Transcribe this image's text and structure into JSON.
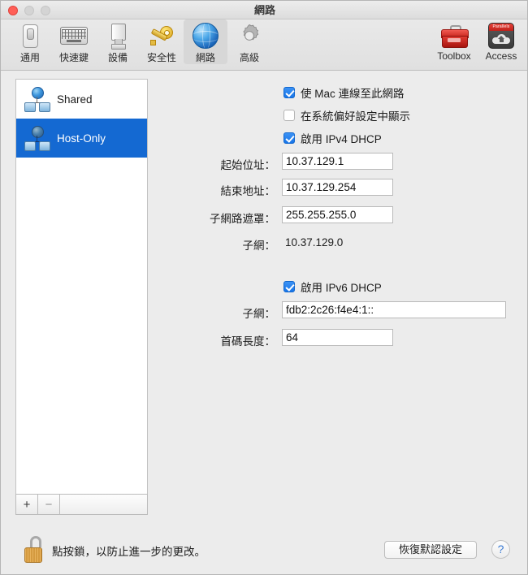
{
  "window": {
    "title": "網路",
    "traffic": {
      "close": "close-button",
      "minimize": "minimize-button",
      "zoom": "zoom-button"
    }
  },
  "toolbar": {
    "items": [
      {
        "label": "通用",
        "icon": "toggle-switch-icon",
        "selected": false
      },
      {
        "label": "快速鍵",
        "icon": "keyboard-icon",
        "selected": false
      },
      {
        "label": "設備",
        "icon": "usb-device-icon",
        "selected": false
      },
      {
        "label": "安全性",
        "icon": "key-icon",
        "selected": false
      },
      {
        "label": "網路",
        "icon": "globe-icon",
        "selected": true
      },
      {
        "label": "高級",
        "icon": "gear-icon",
        "selected": false
      }
    ],
    "right_items": [
      {
        "label": "Toolbox",
        "icon": "toolbox-icon"
      },
      {
        "label": "Access",
        "icon": "access-cloud-house-icon"
      }
    ]
  },
  "sidebar": {
    "items": [
      {
        "label": "Shared",
        "icon": "network-icon",
        "selected": false
      },
      {
        "label": "Host-Only",
        "icon": "network-icon",
        "selected": true
      }
    ],
    "add_label": "+",
    "remove_label": "−"
  },
  "main": {
    "checkboxes": [
      {
        "label": "使 Mac 連線至此網路",
        "checked": true
      },
      {
        "label": "在系統偏好設定中顯示",
        "checked": false
      },
      {
        "label": "啟用 IPv4 DHCP",
        "checked": true
      }
    ],
    "ipv4_fields": [
      {
        "label": "起始位址：",
        "value": "10.37.129.1"
      },
      {
        "label": "結束地址：",
        "value": "10.37.129.254"
      },
      {
        "label": "子網路遮罩：",
        "value": "255.255.255.0"
      }
    ],
    "ipv4_static": {
      "label": "子網：",
      "value": "10.37.129.0"
    },
    "ipv6_checkbox": {
      "label": "啟用 IPv6 DHCP",
      "checked": true
    },
    "ipv6_fields": [
      {
        "label": "子網：",
        "value": "fdb2:2c26:f4e4:1::"
      },
      {
        "label": "首碼長度：",
        "value": "64"
      }
    ]
  },
  "footer": {
    "lock_icon": "unlocked-padlock-icon",
    "lock_message": "點按鎖，以防止進一步的更改。",
    "restore_defaults_label": "恢復默認設定",
    "help_label": "?"
  },
  "colors": {
    "selection_blue": "#1469d2",
    "checkbox_blue": "#1775e8",
    "window_bg": "#ececec",
    "help_blue": "#3b7bd4"
  }
}
